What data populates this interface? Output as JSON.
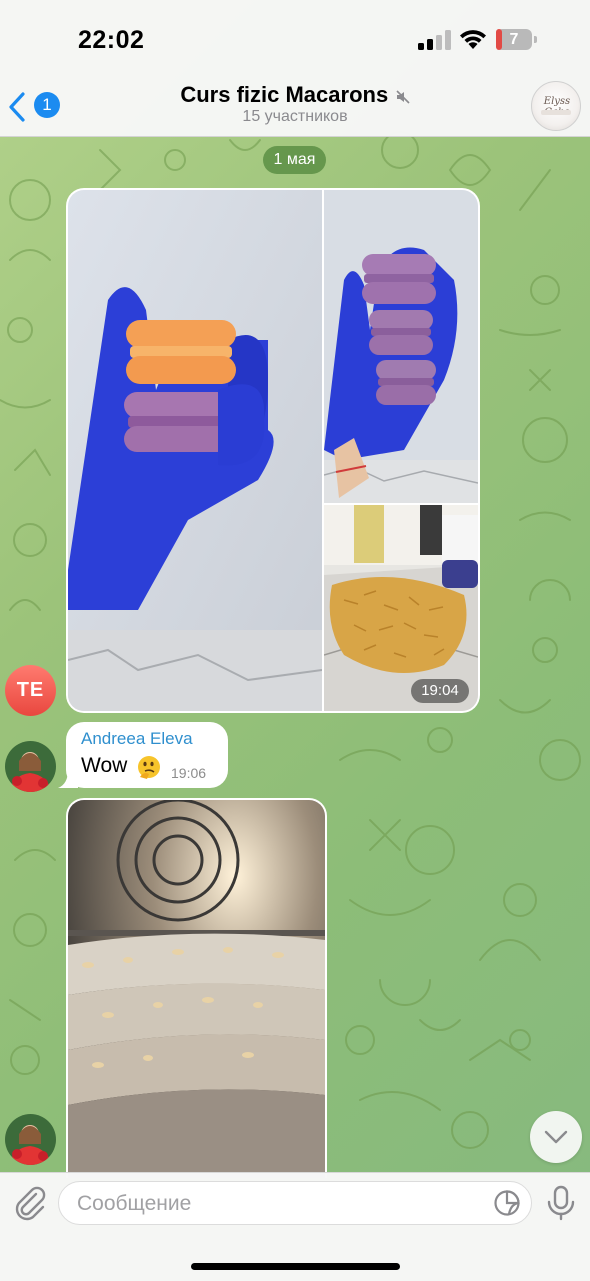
{
  "status_bar": {
    "time": "22:02",
    "battery_level": "7",
    "battery_fraction": 0.07,
    "icons": [
      "cellular-signal-icon",
      "wifi-icon",
      "battery-icon"
    ]
  },
  "header": {
    "back_badge": "1",
    "title": "Curs fizic Macarons",
    "subtitle": "15 участников",
    "avatar_text": "Elyss Cake",
    "icons": [
      "chevron-left-icon",
      "muted-speaker-icon"
    ]
  },
  "messages": {
    "date_separator": "1 мая",
    "album_time": "19:04",
    "album_sender_initials": "TE",
    "text_message": {
      "sender": "Andreea Eleva",
      "text": "Wow",
      "emoji": "thinking-face",
      "time": "19:06"
    }
  },
  "input": {
    "placeholder": "Сообщение",
    "icons": [
      "paperclip-icon",
      "sticker-icon",
      "microphone-icon",
      "chevron-down-icon"
    ]
  },
  "colors": {
    "accent": "#1b8bf0",
    "sender_name": "#2f8fce",
    "chat_background": "#9cc37a",
    "initials_avatar": "#e9473f",
    "date_pill": "#52873c"
  }
}
